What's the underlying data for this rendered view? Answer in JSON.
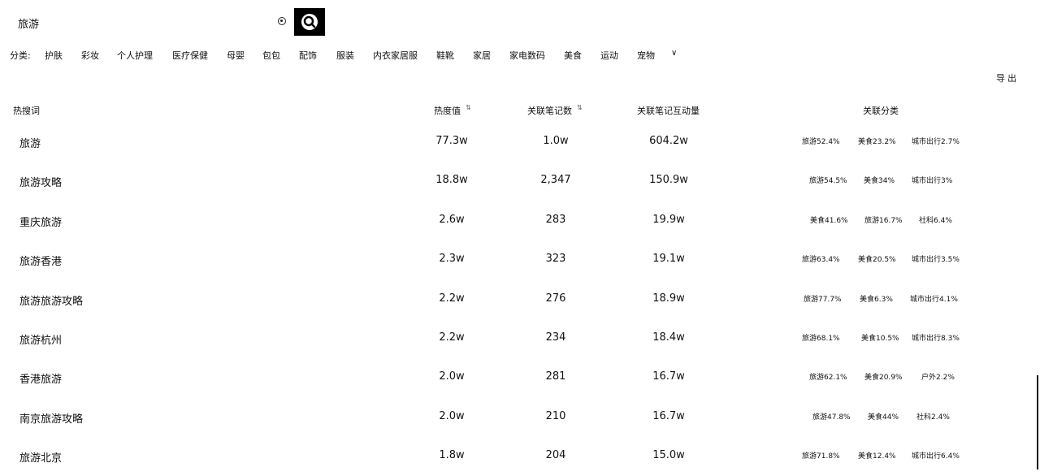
{
  "search": {
    "value": "旅游"
  },
  "categories": {
    "label": "分类:",
    "items": [
      "护肤",
      "彩妆",
      "个人护理",
      "医疗保健",
      "母婴",
      "包包",
      "配饰",
      "服装",
      "内衣家居服",
      "鞋靴",
      "家居",
      "家电数码",
      "美食",
      "运动",
      "宠物"
    ],
    "more_chevron": "∨"
  },
  "export_label": "导出",
  "table": {
    "headers": {
      "keyword": "热搜词",
      "heat": "热度值",
      "notes": "关联笔记数",
      "interact": "关联笔记互动量",
      "category": "关联分类"
    },
    "rows": [
      {
        "keyword": "旅游",
        "heat": "77.3w",
        "notes": "1.0w",
        "interact": "604.2w",
        "cats": [
          "旅游52.4%",
          "美食23.2%",
          "城市出行2.7%"
        ]
      },
      {
        "keyword": "旅游攻略",
        "heat": "18.8w",
        "notes": "2,347",
        "interact": "150.9w",
        "cats": [
          "旅游54.5%",
          "美食34%",
          "城市出行3%"
        ]
      },
      {
        "keyword": "重庆旅游",
        "heat": "2.6w",
        "notes": "283",
        "interact": "19.9w",
        "cats": [
          "美食41.6%",
          "旅游16.7%",
          "社科6.4%"
        ]
      },
      {
        "keyword": "旅游香港",
        "heat": "2.3w",
        "notes": "323",
        "interact": "19.1w",
        "cats": [
          "旅游63.4%",
          "美食20.5%",
          "城市出行3.5%"
        ]
      },
      {
        "keyword": "旅游旅游攻略",
        "heat": "2.2w",
        "notes": "276",
        "interact": "18.9w",
        "cats": [
          "旅游77.7%",
          "美食6.3%",
          "城市出行4.1%"
        ]
      },
      {
        "keyword": "旅游杭州",
        "heat": "2.2w",
        "notes": "234",
        "interact": "18.4w",
        "cats": [
          "旅游68.1%",
          "美食10.5%",
          "城市出行8.3%"
        ]
      },
      {
        "keyword": "香港旅游",
        "heat": "2.0w",
        "notes": "281",
        "interact": "16.7w",
        "cats": [
          "旅游62.1%",
          "美食20.9%",
          "户外2.2%"
        ]
      },
      {
        "keyword": "南京旅游攻略",
        "heat": "2.0w",
        "notes": "210",
        "interact": "16.7w",
        "cats": [
          "旅游47.8%",
          "美食44%",
          "社科2.4%"
        ]
      },
      {
        "keyword": "旅游北京",
        "heat": "1.8w",
        "notes": "204",
        "interact": "15.0w",
        "cats": [
          "旅游71.8%",
          "美食12.4%",
          "城市出行6.4%"
        ]
      }
    ]
  },
  "icons": {
    "search": "search-icon",
    "clear": "clear-icon",
    "sort": "sort-icon",
    "chevron": "chevron-down-icon"
  }
}
